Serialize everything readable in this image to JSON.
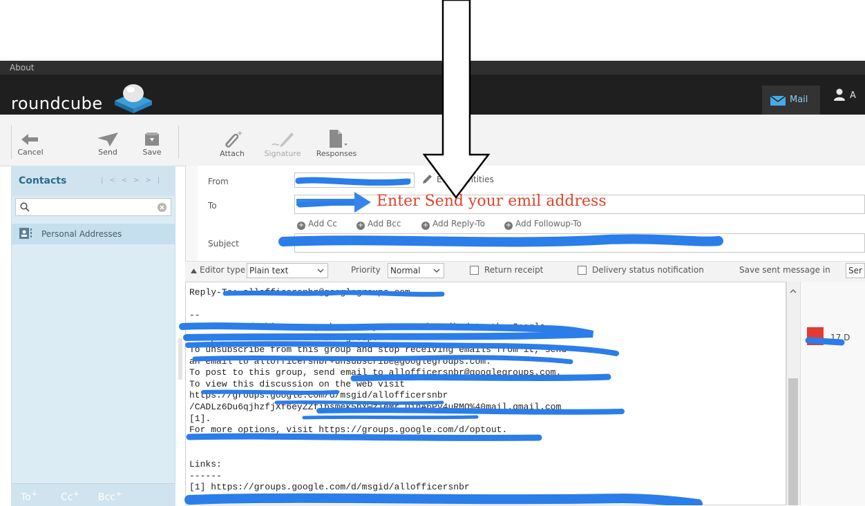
{
  "topbar": {
    "about_label": "About"
  },
  "header": {
    "logo_text": "roundcube",
    "mail_tab_label": "Mail",
    "user_tab_label": "A",
    "accent_color": "#8ecbf0"
  },
  "toolbar": {
    "cancel_label": "Cancel",
    "send_label": "Send",
    "save_label": "Save",
    "attach_label": "Attach",
    "signature_label": "Signature",
    "responses_label": "Responses"
  },
  "contacts": {
    "title": "Contacts",
    "nav": "K < > >I",
    "search_placeholder": "",
    "group_label": "Personal Addresses",
    "footer": {
      "to_label": "To",
      "cc_label": "Cc",
      "bcc_label": "Bcc"
    }
  },
  "compose": {
    "from_label": "From",
    "edit_identities_label": "Edit identities",
    "to_label": "To",
    "add_cc_label": "Add Cc",
    "add_bcc_label": "Add Bcc",
    "add_reply_to_label": "Add Reply-To",
    "add_followup_to_label": "Add Followup-To",
    "subject_label": "Subject"
  },
  "options": {
    "editor_type_label": "Editor type",
    "editor_type_value": "Plain text",
    "priority_label": "Priority",
    "priority_value": "Normal",
    "return_receipt_label": "Return receipt",
    "delivery_status_label": "Delivery status notification",
    "save_sent_label": "Save sent message in",
    "save_sent_value": "Ser"
  },
  "editor": {
    "body": "Reply-To: allofficersnbr@googlegroups.com\n\n--\nYou received this message because you are subscribed to the Google\nGroups \"All officers of NBR\" group.\nTo unsubscribe from this group and stop receiving emails from it, send\nan email to allofficersnbr+unsubscribe@googlegroups.com.\nTo post to this group, send email to allofficersnbr@googlegroups.com.\nTo view this discussion on the web visit\nhttps://groups.google.com/d/msgid/allofficersnbr\n/CADLz6Du6qjhzfjXf6eyZZfibsmek5bYwz1eMr_DihA6Pv4uRMQ%40mail.gmail.com\n[1].\nFor more options, visit https://groups.google.com/d/optout.\n\n\nLinks:\n------\n[1] https://groups.google.com/d/msgid/allofficersnbr"
  },
  "attachments": {
    "item_label": "17 D"
  },
  "annotation": {
    "text": "Enter Send your emil address",
    "color": "#e0422a"
  }
}
